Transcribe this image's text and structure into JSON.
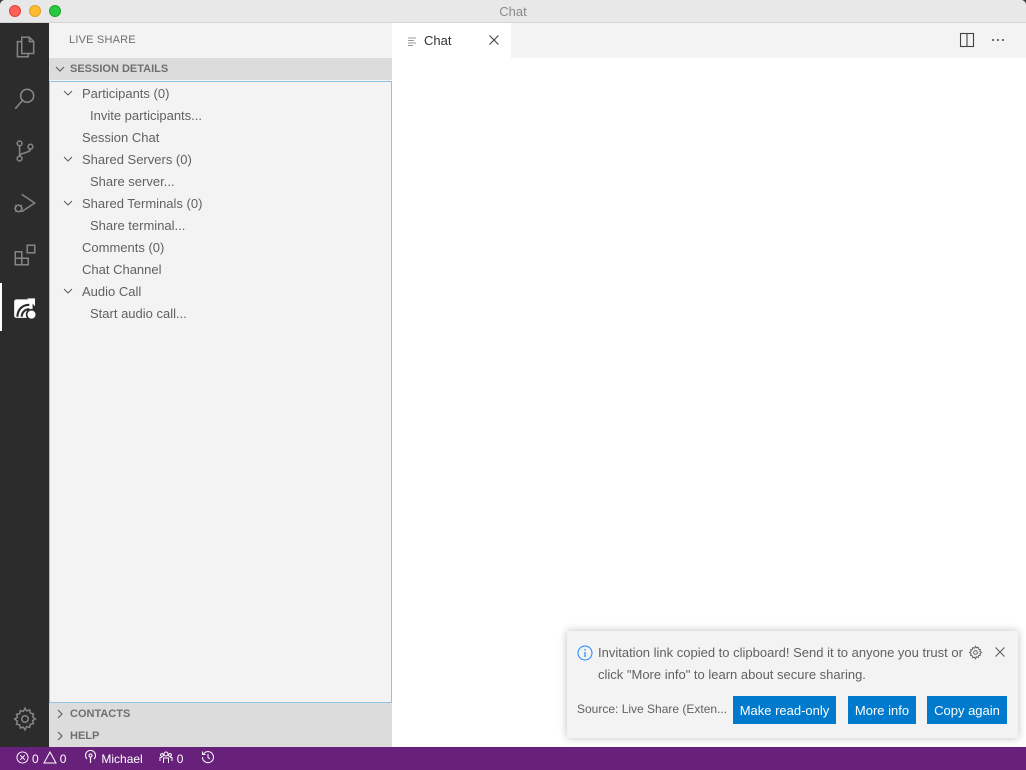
{
  "window": {
    "title": "Chat"
  },
  "activity_bar": {
    "items": [
      {
        "icon": "files-icon"
      },
      {
        "icon": "search-icon"
      },
      {
        "icon": "source-control-icon"
      },
      {
        "icon": "run-debug-icon"
      },
      {
        "icon": "extensions-icon"
      },
      {
        "icon": "live-share-icon",
        "active": true
      }
    ],
    "bottom": {
      "icon": "gear-icon"
    }
  },
  "sidebar": {
    "title": "LIVE SHARE",
    "sections": {
      "session_details": "SESSION DETAILS",
      "contacts": "CONTACTS",
      "help": "HELP"
    },
    "tree": [
      {
        "label": "Participants (0)",
        "expanded": true,
        "level": 0
      },
      {
        "label": "Invite participants...",
        "level": 1
      },
      {
        "label": "Session Chat",
        "level": 0
      },
      {
        "label": "Shared Servers (0)",
        "expanded": true,
        "level": 0
      },
      {
        "label": "Share server...",
        "level": 1
      },
      {
        "label": "Shared Terminals (0)",
        "expanded": true,
        "level": 0
      },
      {
        "label": "Share terminal...",
        "level": 1
      },
      {
        "label": "Comments (0)",
        "level": 0
      },
      {
        "label": "Chat Channel",
        "level": 0
      },
      {
        "label": "Audio Call",
        "expanded": true,
        "level": 0
      },
      {
        "label": "Start audio call...",
        "level": 1
      }
    ]
  },
  "editor": {
    "tabs": [
      {
        "label": "Chat",
        "active": true
      }
    ]
  },
  "notification": {
    "message": "Invitation link copied to clipboard! Send it to anyone you trust or click \"More info\" to learn about secure sharing.",
    "source": "Source: Live Share (Exten...",
    "buttons": {
      "read_only": "Make read-only",
      "more_info": "More info",
      "copy_again": "Copy again"
    }
  },
  "status_bar": {
    "errors": "0",
    "warnings": "0",
    "user": "Michael",
    "participants": "0",
    "color": "#68217a"
  }
}
